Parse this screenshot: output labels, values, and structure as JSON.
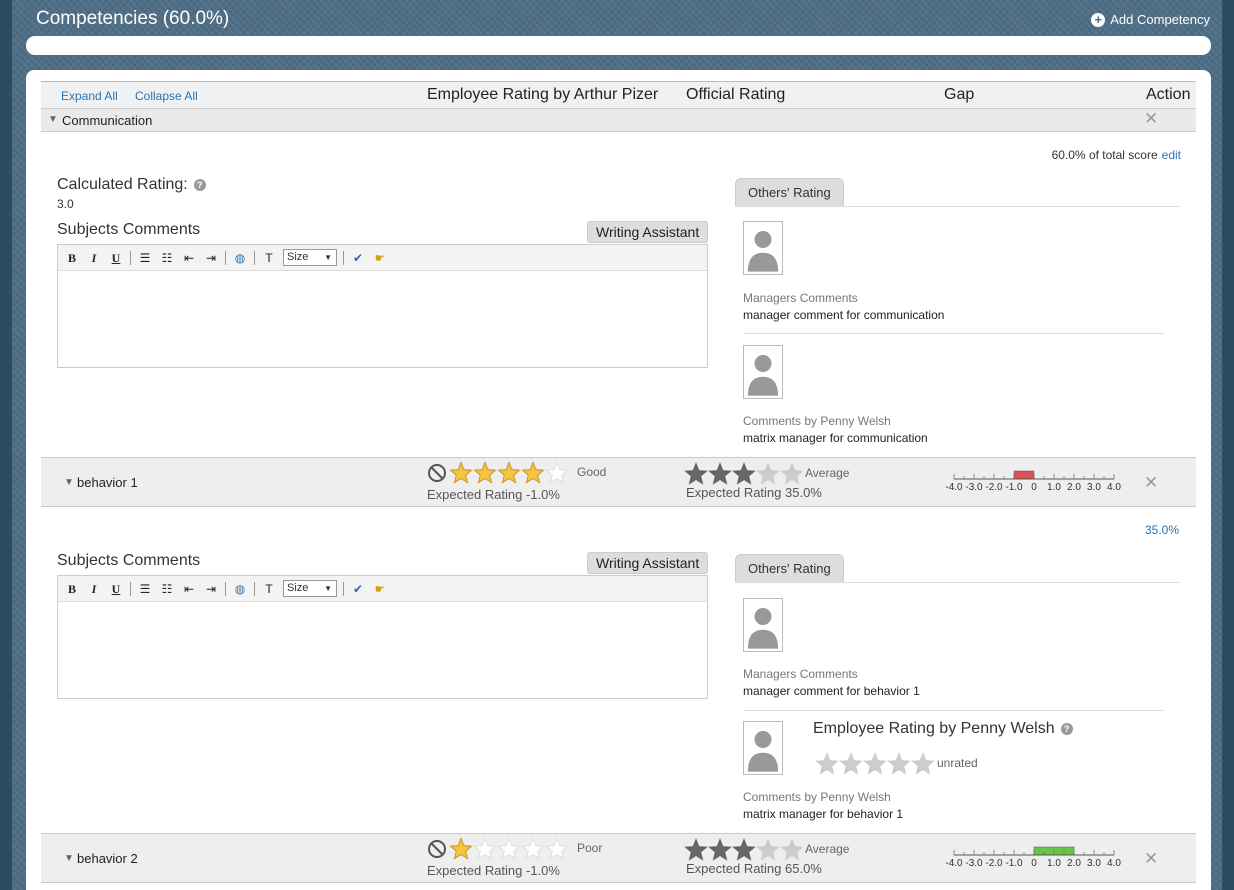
{
  "page": {
    "title": "Competencies (60.0%)",
    "add_competency": "Add Competency"
  },
  "header": {
    "expand_all": "Expand All",
    "collapse_all": "Collapse All",
    "col_employee": "Employee Rating by Arthur Pizer",
    "col_official": "Official Rating",
    "col_gap": "Gap",
    "col_action": "Action"
  },
  "competency": {
    "name": "Communication",
    "score_text": "60.0% of total score",
    "edit_label": "edit",
    "calc_label": "Calculated Rating:",
    "calc_value": "3.0"
  },
  "editor": {
    "subjects_label": "Subjects Comments",
    "writing_assistant": "Writing Assistant",
    "size_label": "Size",
    "others_tab": "Others' Rating"
  },
  "others_comp": [
    {
      "title": "Managers Comments",
      "text": "manager comment for communication"
    },
    {
      "title": "Comments by Penny Welsh",
      "text": "matrix manager for communication"
    }
  ],
  "behaviors": [
    {
      "name": "behavior 1",
      "employee_rating": 4,
      "employee_label": "Good",
      "employee_expected": "Expected Rating -1.0%",
      "official_rating": 3,
      "official_label": "Average",
      "official_expected": "Expected Rating 35.0%",
      "gap": -1.0,
      "gap_color": "#e05050"
    },
    {
      "name": "behavior 2",
      "employee_rating": 1,
      "employee_label": "Poor",
      "employee_expected": "Expected Rating -1.0%",
      "official_rating": 3,
      "official_label": "Average",
      "official_expected": "Expected Rating 65.0%",
      "gap": 2.0,
      "gap_color": "#6ac54a"
    }
  ],
  "behavior1_detail": {
    "weight": "35.0%",
    "managers_title": "Managers Comments",
    "managers_text": "manager comment for behavior 1",
    "penny_rating_title": "Employee Rating by Penny Welsh",
    "penny_rating_label": "unrated",
    "penny_title": "Comments by Penny Welsh",
    "penny_text": "matrix manager for behavior 1"
  },
  "gap_axis": {
    "ticks": [
      "-4.0",
      "-3.0",
      "-2.0",
      "-1.0",
      "0",
      "1.0",
      "2.0",
      "3.0",
      "4.0"
    ],
    "range": [
      -4,
      4
    ]
  },
  "colors": {
    "link": "#2a74b0",
    "star_gold": "#f5c542",
    "star_dark": "#666666",
    "star_empty": "#cccccc"
  }
}
